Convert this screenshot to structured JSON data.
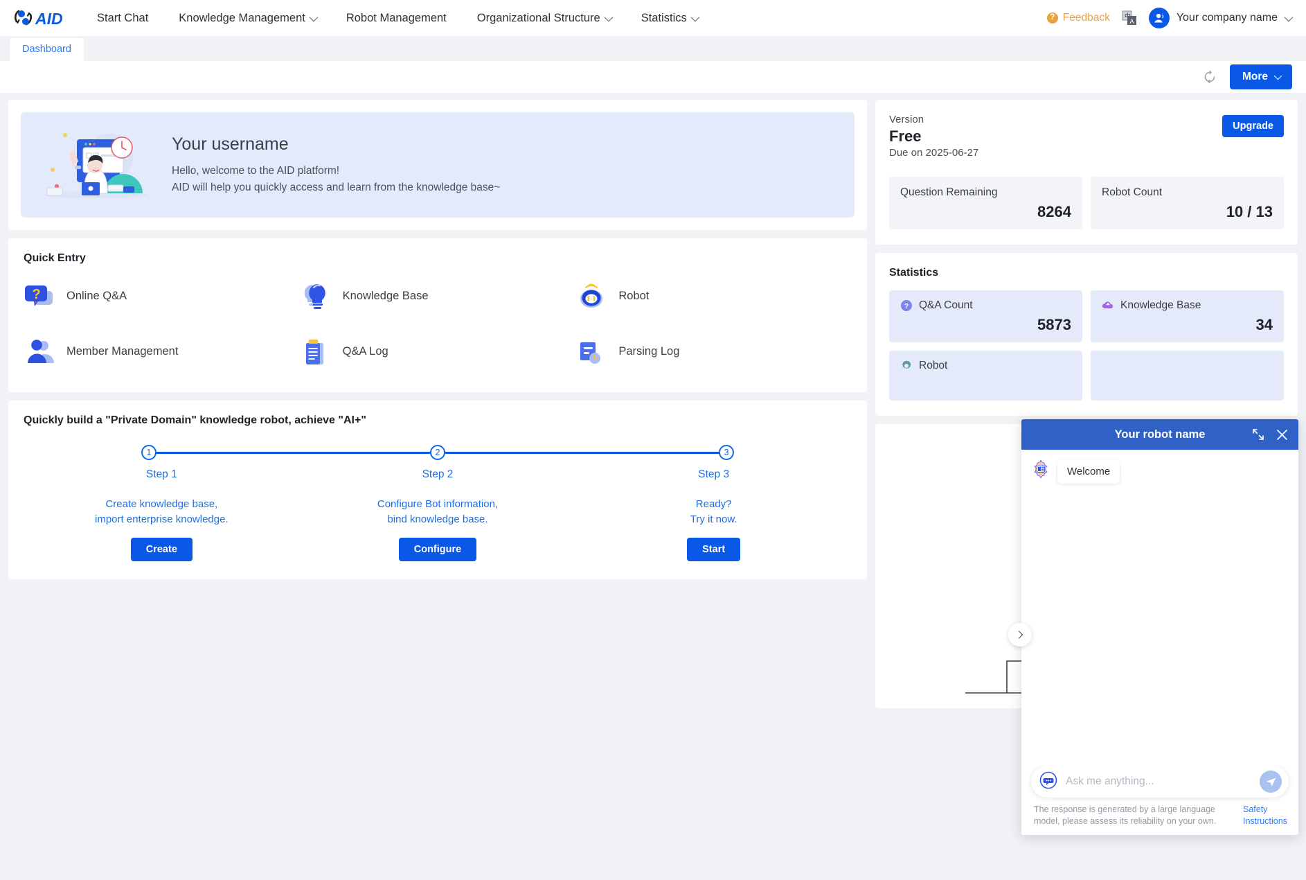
{
  "header": {
    "logo_text": "AID",
    "nav": [
      {
        "label": "Start Chat",
        "has_caret": false
      },
      {
        "label": "Knowledge Management",
        "has_caret": true
      },
      {
        "label": "Robot Management",
        "has_caret": false
      },
      {
        "label": "Organizational Structure",
        "has_caret": true
      },
      {
        "label": "Statistics",
        "has_caret": true
      }
    ],
    "feedback_label": "Feedback",
    "feedback_color": "#e8a33d",
    "language_icon": "translate-icon",
    "company_label": "Your company name"
  },
  "tabs": [
    {
      "label": "Dashboard",
      "active": true
    }
  ],
  "toolbar": {
    "refresh_icon": "refresh-icon",
    "more_label": "More"
  },
  "banner": {
    "username": "Your username",
    "line1": "Hello, welcome to the AID platform!",
    "line2": "AID will help you quickly access and learn from the knowledge base~",
    "background": "#e3eafb"
  },
  "quick_entry": {
    "title": "Quick Entry",
    "items": [
      {
        "label": "Online Q&A",
        "icon": "question-bubble-icon"
      },
      {
        "label": "Knowledge Base",
        "icon": "lightbulb-icon"
      },
      {
        "label": "Robot",
        "icon": "robot-head-icon"
      },
      {
        "label": "Member Management",
        "icon": "users-icon"
      },
      {
        "label": "Q&A Log",
        "icon": "clipboard-icon"
      },
      {
        "label": "Parsing Log",
        "icon": "document-clock-icon"
      }
    ]
  },
  "steps_section": {
    "title": "Quickly build a \"Private Domain\" knowledge robot, achieve \"AI+\"",
    "steps": [
      {
        "number": "1",
        "name": "Step 1",
        "desc_line1": "Create knowledge base,",
        "desc_line2": "import enterprise knowledge.",
        "button": "Create"
      },
      {
        "number": "2",
        "name": "Step 2",
        "desc_line1": "Configure Bot information,",
        "desc_line2": "bind knowledge base.",
        "button": "Configure"
      },
      {
        "number": "3",
        "name": "Step 3",
        "desc_line1": "Ready?",
        "desc_line2": "Try it now.",
        "button": "Start"
      }
    ]
  },
  "version_card": {
    "label": "Version",
    "name": "Free",
    "due": "Due on 2025-06-27",
    "upgrade_label": "Upgrade",
    "tiles": [
      {
        "label": "Question Remaining",
        "value": "8264"
      },
      {
        "label": "Robot Count",
        "value": "10 / 13"
      }
    ]
  },
  "statistics_card": {
    "title": "Statistics",
    "tiles": [
      {
        "label": "Q&A Count",
        "value": "5873",
        "icon": "question-circle-icon",
        "icon_color": "#7b86e8"
      },
      {
        "label": "Knowledge Base",
        "value": "34",
        "icon": "cloud-upload-icon",
        "icon_color": "#9b68e0"
      },
      {
        "label": "Robot",
        "value": "",
        "icon": "gear-icon",
        "icon_color": "#5f9a9c"
      },
      {
        "label": "",
        "value": "",
        "icon": "",
        "icon_color": ""
      }
    ]
  },
  "illustration": {
    "name": "person-climbing-stairs-illustration"
  },
  "chat_widget": {
    "title": "Your robot name",
    "expand_icon": "expand-icon",
    "close_icon": "close-icon",
    "collapse_icon": "chevron-right-icon",
    "bot_avatar_icon": "bot-avatar-icon",
    "messages": [
      {
        "from": "bot",
        "text": "Welcome"
      }
    ],
    "input_placeholder": "Ask me anything...",
    "input_value": "",
    "input_icon": "chat-bubble-icon",
    "send_icon": "send-icon",
    "disclaimer": "The response is generated by a large language model, please assess its reliability on your own.",
    "safety_link": "Safety Instructions",
    "header_color": "#2f62c4"
  },
  "theme": {
    "accent": "#0a58e6",
    "page_bg": "#f1f2f6",
    "card_bg": "#ffffff"
  }
}
